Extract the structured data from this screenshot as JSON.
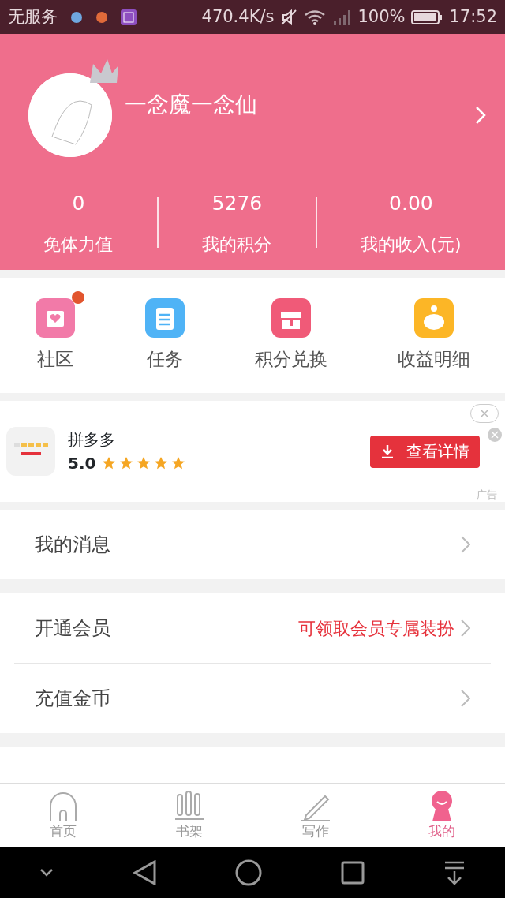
{
  "status_bar": {
    "carrier": "无服务",
    "speed": "470.4K/s",
    "battery": "100%",
    "time": "17:52"
  },
  "profile": {
    "username": "一念魔一念仙"
  },
  "stats": [
    {
      "value": "0",
      "label": "免体力值"
    },
    {
      "value": "5276",
      "label": "我的积分"
    },
    {
      "value": "0.00",
      "label": "我的收入(元)"
    }
  ],
  "shortcuts": [
    {
      "label": "社区",
      "kind": "community",
      "color": "#f27aa8",
      "badge": true
    },
    {
      "label": "任务",
      "kind": "task",
      "color": "#4fb3f6",
      "badge": false
    },
    {
      "label": "积分兑换",
      "kind": "gift",
      "color": "#f05a78",
      "badge": false
    },
    {
      "label": "收益明细",
      "kind": "piggy",
      "color": "#fcb626",
      "badge": false
    }
  ],
  "ad": {
    "app_name": "拼多多",
    "rating": "5.0",
    "stars": 5,
    "button": "查看详情",
    "tag": "广告"
  },
  "menu_groups": [
    [
      {
        "label": "我的消息"
      }
    ],
    [
      {
        "label": "开通会员",
        "note": "可领取会员专属装扮"
      },
      {
        "label": "充值金币"
      }
    ]
  ],
  "tabs": [
    {
      "label": "首页",
      "kind": "home",
      "selected": false
    },
    {
      "label": "书架",
      "kind": "shelf",
      "selected": false
    },
    {
      "label": "写作",
      "kind": "write",
      "selected": false
    },
    {
      "label": "我的",
      "kind": "me",
      "selected": true
    }
  ]
}
